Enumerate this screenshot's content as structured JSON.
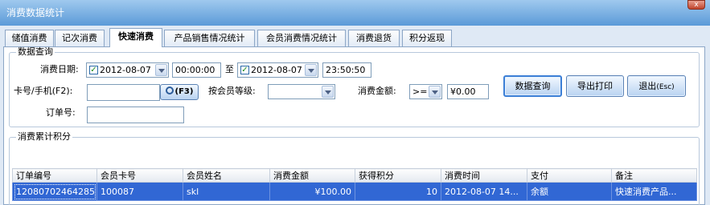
{
  "window": {
    "title": "消费数据统计",
    "close_label": "x"
  },
  "tabs": [
    {
      "label": "储值消费",
      "active": false
    },
    {
      "label": "记次消费",
      "active": false
    },
    {
      "label": "快速消费",
      "active": true
    },
    {
      "label": "产品销售情况统计",
      "active": false
    },
    {
      "label": "会员消费情况统计",
      "active": false
    },
    {
      "label": "消费退货",
      "active": false
    },
    {
      "label": "积分返现",
      "active": false
    }
  ],
  "query": {
    "legend": "数据查询",
    "date_label": "消费日期:",
    "start_date": "2012-08-07",
    "start_date_checked": true,
    "start_time": "00:00:00",
    "to_label": "至",
    "end_date": "2012-08-07",
    "end_date_checked": true,
    "end_time": "23:50:50",
    "card_label": "卡号/手机(F2):",
    "card_value": "",
    "f3_label": "(F3)",
    "level_label": "按会员等级:",
    "level_value": "",
    "amount_label": "消费金额:",
    "amount_op": ">=",
    "amount_value": "¥0.00",
    "order_label": "订单号:",
    "order_value": "",
    "search_button": "数据查询",
    "export_button": "导出打印",
    "exit_button": "退出",
    "exit_hint": "(Esc)"
  },
  "results": {
    "legend": "消费累计积分",
    "columns": [
      "订单编号",
      "会员卡号",
      "会员姓名",
      "消费金额",
      "获得积分",
      "消费时间",
      "支付",
      "备注"
    ],
    "rows": [
      [
        "12080702464285",
        "100087",
        "skl",
        "¥100.00",
        "10",
        "2012-08-07 14...",
        "余额",
        "快速消费产品..."
      ]
    ]
  }
}
